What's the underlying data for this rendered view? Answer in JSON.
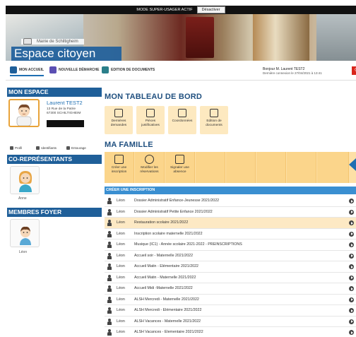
{
  "superbar": {
    "text": "MODE SUPER-USAGER ACTIF",
    "button": "Désactiver"
  },
  "banner": {
    "mairie": "Mairie de Schiltigheim",
    "title": "Espace citoyen"
  },
  "nav": {
    "items": [
      {
        "label": "MON ACCUEIL",
        "icon": "home-icon"
      },
      {
        "label": "NOUVELLE DÉMARCHE",
        "icon": "new-request-icon"
      },
      {
        "label": "EDITION DE DOCUMENTS",
        "icon": "print-icon"
      }
    ],
    "greeting": "Bonjour M. Laurent TEST2",
    "last_login": "Dernière connexion le 27/04/2021 à 13:41"
  },
  "sidebar": {
    "mon_espace": "MON ESPACE",
    "user": {
      "name": "Laurent TEST2",
      "address_line1": "13 Rue de la Patrie",
      "address_line2": "67300 SCHILTIGHEIM"
    },
    "tabs": [
      {
        "label": "Profil",
        "icon": "user-icon"
      },
      {
        "label": "Identifiants",
        "icon": "lock-icon"
      },
      {
        "label": "Entourage",
        "icon": "group-icon"
      }
    ],
    "co_representants": "CO-REPRÉSENTANTS",
    "co_rep_name": "Anne",
    "membres_foyer": "MEMBRES FOYER",
    "member_name": "Léon"
  },
  "dashboard": {
    "title": "MON TABLEAU DE BORD",
    "tiles": [
      {
        "label": "Dernières demandes",
        "icon": "document-list-icon"
      },
      {
        "label": "Pièces justificatives",
        "icon": "attachment-icon"
      },
      {
        "label": "Coordonnées",
        "icon": "contact-card-icon"
      },
      {
        "label": "Edition de documents",
        "icon": "printer-icon"
      }
    ]
  },
  "famille": {
    "title": "MA FAMILLE",
    "tiles": [
      {
        "label": "Créer une inscription",
        "icon": "create-icon"
      },
      {
        "label": "Modifier les réservations",
        "icon": "clock-icon"
      },
      {
        "label": "Signaler une absence",
        "icon": "absence-icon"
      }
    ]
  },
  "inscription": {
    "header": "CRÉER UNE INSCRIPTION",
    "rows": [
      {
        "name": "Léon",
        "label": "Dossier Administratif Enfance-Jeunesse 2021/2022",
        "highlight": false
      },
      {
        "name": "Léon",
        "label": "Dossier Administratif Petite Enfance 2021/2022",
        "highlight": false
      },
      {
        "name": "Léon",
        "label": "Restauration scolaire 2021/2022",
        "highlight": true
      },
      {
        "name": "Léon",
        "label": "Inscription scolaire maternelle 2021/2022",
        "highlight": false
      },
      {
        "name": "Léon",
        "label": "Musique (IC1) - Année scolaire 2021-2022 - PREINSCRIPTIONS",
        "highlight": false
      },
      {
        "name": "Léon",
        "label": "Accueil soir - Maternelle 2021/2022",
        "highlight": false
      },
      {
        "name": "Léon",
        "label": "Accueil Matin - Elémentaire 2021/2022",
        "highlight": false
      },
      {
        "name": "Léon",
        "label": "Accueil Matin - Maternelle 2021/2022",
        "highlight": false
      },
      {
        "name": "Léon",
        "label": "Accueil Midi -Maternelle 2021/2022",
        "highlight": false
      },
      {
        "name": "Léon",
        "label": "ALSH Mercredi - Maternelle 2021/2022",
        "highlight": false
      },
      {
        "name": "Léon",
        "label": "ALSH Mercredi - Elémentaire 2021/2022",
        "highlight": false
      },
      {
        "name": "Léon",
        "label": "ALSH Vacances - Maternelle 2021/2022",
        "highlight": false
      },
      {
        "name": "Léon",
        "label": "ALSH Vacances - Elementaire 2021/2022",
        "highlight": false
      }
    ]
  },
  "colors": {
    "primary": "#1f5f99",
    "accent": "#3a8fd1",
    "tile": "#fde9c0",
    "family_tile": "#fbd58b",
    "logout": "#d9261c"
  }
}
